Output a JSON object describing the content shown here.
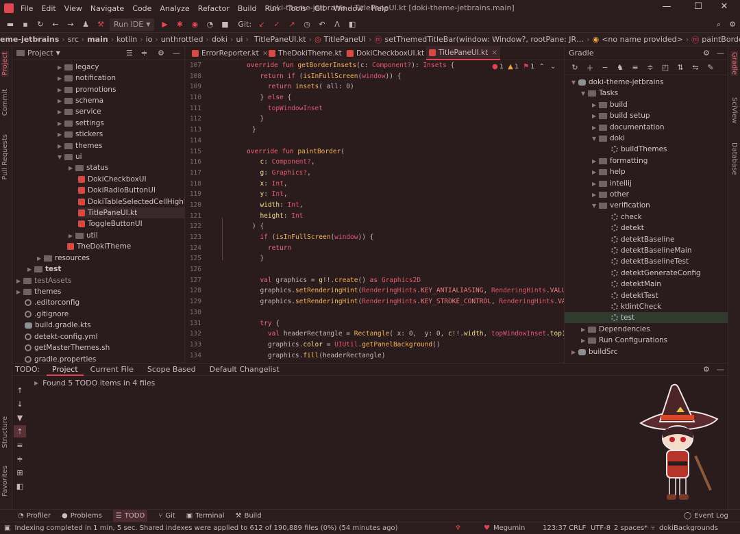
{
  "window": {
    "title": "doki-theme-jetbrains – TitlePaneUI.kt [doki-theme-jetbrains.main]"
  },
  "menu": [
    "File",
    "Edit",
    "View",
    "Navigate",
    "Code",
    "Analyze",
    "Refactor",
    "Build",
    "Run",
    "Tools",
    "Git",
    "Window",
    "Help"
  ],
  "toolbar": {
    "run_config": "Run IDE",
    "git_label": "Git:"
  },
  "breadcrumbs": [
    "eme-jetbrains",
    "src",
    "main",
    "kotlin",
    "io",
    "unthrottled",
    "doki",
    "ui",
    "TitlePaneUI.kt",
    "TitlePaneUI",
    "setThemedTitleBar(window: Window?, rootPane: JR…",
    "<no name provided>",
    "paintBorder(c: Component?, g: Graphics?, x: Int…"
  ],
  "left_strip": {
    "project": "Project",
    "commit": "Commit",
    "pull_requests": "Pull Requests",
    "structure": "Structure",
    "favorites": "Favorites"
  },
  "right_strip": {
    "gradle": "Gradle",
    "sciview": "SciView",
    "database": "Database"
  },
  "project_panel": {
    "title": "Project",
    "items": [
      "legacy",
      "notification",
      "promotions",
      "schema",
      "service",
      "settings",
      "stickers",
      "themes",
      "ui",
      "status",
      "DokiCheckboxUI",
      "DokiRadioButtonUI",
      "DokiTableSelectedCellHighlight",
      "TitlePaneUI.kt",
      "ToggleButtonUI",
      "util",
      "TheDokiTheme",
      "resources",
      "test",
      "testAssets",
      "themes",
      ".editorconfig",
      ".gitignore",
      "build.gradle.kts",
      "detekt-config.yml",
      "getMasterThemes.sh",
      "gradle.properties"
    ]
  },
  "editor": {
    "tabs": [
      "ErrorReporter.kt",
      "TheDokiTheme.kt",
      "DokiCheckboxUI.kt",
      "TitlePaneUI.kt"
    ],
    "inspection": {
      "errors": "1",
      "warnings": "1",
      "weak": "1"
    },
    "line_numbers": [
      "107",
      "108",
      "109",
      "110",
      "111",
      "112",
      "113",
      "114",
      "115",
      "116",
      "117",
      "118",
      "119",
      "120",
      "121",
      "122",
      "123",
      "124",
      "125",
      "126",
      "127",
      "128",
      "129",
      "130",
      "131",
      "132",
      "133",
      "134"
    ],
    "lines": [
      [
        [
          "k",
          "override fun "
        ],
        [
          "f",
          "getBorderInsets"
        ],
        [
          "n",
          "(c: "
        ],
        [
          "t",
          "Component?"
        ],
        [
          "n",
          "): "
        ],
        [
          "t",
          "Insets"
        ],
        [
          "n",
          " {"
        ]
      ],
      [
        [
          "n",
          "  "
        ],
        [
          "k",
          "return if "
        ],
        [
          "n",
          "("
        ],
        [
          "f",
          "isInFullScreen"
        ],
        [
          "n",
          "("
        ],
        [
          "s",
          "window"
        ],
        [
          "n",
          ")) {"
        ]
      ],
      [
        [
          "n",
          "    "
        ],
        [
          "k",
          "return "
        ],
        [
          "f",
          "insets"
        ],
        [
          "n",
          "( all: 0)"
        ]
      ],
      [
        [
          "n",
          "  } "
        ],
        [
          "k",
          "else"
        ],
        [
          "n",
          " {"
        ]
      ],
      [
        [
          "n",
          "    "
        ],
        [
          "s",
          "topWindowInset"
        ]
      ],
      [
        [
          "n",
          "  }"
        ]
      ],
      [
        [
          "n",
          "}"
        ]
      ],
      [
        [
          "n",
          ""
        ]
      ],
      [
        [
          "k",
          "override fun "
        ],
        [
          "f",
          "paintBorder"
        ],
        [
          "n",
          "("
        ]
      ],
      [
        [
          "n",
          "  "
        ],
        [
          "p",
          "c"
        ],
        [
          "n",
          ": "
        ],
        [
          "t",
          "Component?"
        ],
        [
          "n",
          ","
        ]
      ],
      [
        [
          "n",
          "  "
        ],
        [
          "p",
          "g"
        ],
        [
          "n",
          ": "
        ],
        [
          "t",
          "Graphics?"
        ],
        [
          "n",
          ","
        ]
      ],
      [
        [
          "n",
          "  "
        ],
        [
          "p",
          "x"
        ],
        [
          "n",
          ": "
        ],
        [
          "t",
          "Int"
        ],
        [
          "n",
          ","
        ]
      ],
      [
        [
          "n",
          "  "
        ],
        [
          "p",
          "y"
        ],
        [
          "n",
          ": "
        ],
        [
          "t",
          "Int"
        ],
        [
          "n",
          ","
        ]
      ],
      [
        [
          "n",
          "  "
        ],
        [
          "p",
          "width"
        ],
        [
          "n",
          ": "
        ],
        [
          "t",
          "Int"
        ],
        [
          "n",
          ","
        ]
      ],
      [
        [
          "n",
          "  "
        ],
        [
          "p",
          "height"
        ],
        [
          "n",
          ": "
        ],
        [
          "t",
          "Int"
        ]
      ],
      [
        [
          "n",
          ") {"
        ]
      ],
      [
        [
          "n",
          "  "
        ],
        [
          "k",
          "if "
        ],
        [
          "n",
          "("
        ],
        [
          "f",
          "isInFullScreen"
        ],
        [
          "n",
          "("
        ],
        [
          "s",
          "window"
        ],
        [
          "n",
          ")) {"
        ]
      ],
      [
        [
          "n",
          "    "
        ],
        [
          "k",
          "return"
        ]
      ],
      [
        [
          "n",
          "  }"
        ]
      ],
      [
        [
          "n",
          ""
        ]
      ],
      [
        [
          "n",
          "  "
        ],
        [
          "k",
          "val "
        ],
        [
          "n",
          "graphics = "
        ],
        [
          "p",
          "g"
        ],
        [
          "n",
          "!!."
        ],
        [
          "f",
          "create"
        ],
        [
          "n",
          "() "
        ],
        [
          "k",
          "as "
        ],
        [
          "t",
          "Graphics2D"
        ]
      ],
      [
        [
          "n",
          "  graphics."
        ],
        [
          "f",
          "setRenderingHint"
        ],
        [
          "n",
          "("
        ],
        [
          "t",
          "RenderingHints"
        ],
        [
          "n",
          "."
        ],
        [
          "pp",
          "KEY_ANTIALIASING"
        ],
        [
          "n",
          ", "
        ],
        [
          "t",
          "RenderingHints"
        ],
        [
          "n",
          "."
        ],
        [
          "pp",
          "VALUE"
        ]
      ],
      [
        [
          "n",
          "  graphics."
        ],
        [
          "f",
          "setRenderingHint"
        ],
        [
          "n",
          "("
        ],
        [
          "t",
          "RenderingHints"
        ],
        [
          "n",
          "."
        ],
        [
          "pp",
          "KEY_STROKE_CONTROL"
        ],
        [
          "n",
          ", "
        ],
        [
          "t",
          "RenderingHints"
        ],
        [
          "n",
          "."
        ],
        [
          "pp",
          "VAL"
        ]
      ],
      [
        [
          "n",
          ""
        ]
      ],
      [
        [
          "n",
          "  "
        ],
        [
          "k",
          "try"
        ],
        [
          "n",
          " {"
        ]
      ],
      [
        [
          "n",
          "    "
        ],
        [
          "k",
          "val "
        ],
        [
          "n",
          "headerRectangle = "
        ],
        [
          "f",
          "Rectangle"
        ],
        [
          "n",
          "( x: 0,  y: 0, "
        ],
        [
          "p",
          "c"
        ],
        [
          "n",
          "!!."
        ],
        [
          "p",
          "width"
        ],
        [
          "n",
          ", "
        ],
        [
          "s",
          "topWindowInset"
        ],
        [
          "n",
          "."
        ],
        [
          "p",
          "top"
        ],
        [
          "n",
          ")"
        ]
      ],
      [
        [
          "n",
          "    graphics."
        ],
        [
          "p",
          "color"
        ],
        [
          "n",
          " = "
        ],
        [
          "t",
          "UIUtil"
        ],
        [
          "n",
          "."
        ],
        [
          "f",
          "getPanelBackground"
        ],
        [
          "n",
          "()"
        ]
      ],
      [
        [
          "n",
          "    graphics."
        ],
        [
          "f",
          "fill"
        ],
        [
          "n",
          "(headerRectangle)"
        ]
      ]
    ]
  },
  "gradle_panel": {
    "title": "Gradle",
    "items": [
      "doki-theme-jetbrains",
      "Tasks",
      "build",
      "build setup",
      "documentation",
      "doki",
      "buildThemes",
      "formatting",
      "help",
      "intellij",
      "other",
      "verification",
      "check",
      "detekt",
      "detektBaseline",
      "detektBaselineMain",
      "detektBaselineTest",
      "detektGenerateConfig",
      "detektMain",
      "detektTest",
      "ktlintCheck",
      "test",
      "Dependencies",
      "Run Configurations",
      "buildSrc"
    ]
  },
  "todo_panel": {
    "label": "TODO:",
    "tabs": [
      "Project",
      "Current File",
      "Scope Based",
      "Default Changelist"
    ],
    "message": "Found 5 TODO items in 4 files"
  },
  "bottom_tools": [
    "Profiler",
    "Problems",
    "TODO",
    "Git",
    "Terminal",
    "Build"
  ],
  "event_log": "Event Log",
  "status": {
    "message": "Indexing completed in 1 min, 5 sec. Shared indexes were applied to 612 of 190,889 files (0%) (54 minutes ago)",
    "theme": "Megumin",
    "position": "123:37",
    "line_sep": "CRLF",
    "encoding": "UTF-8",
    "indent": "2 spaces*",
    "branch": "dokiBackgrounds"
  },
  "colors": {
    "accent": "#e0464f",
    "background": "#2a1b1d"
  }
}
